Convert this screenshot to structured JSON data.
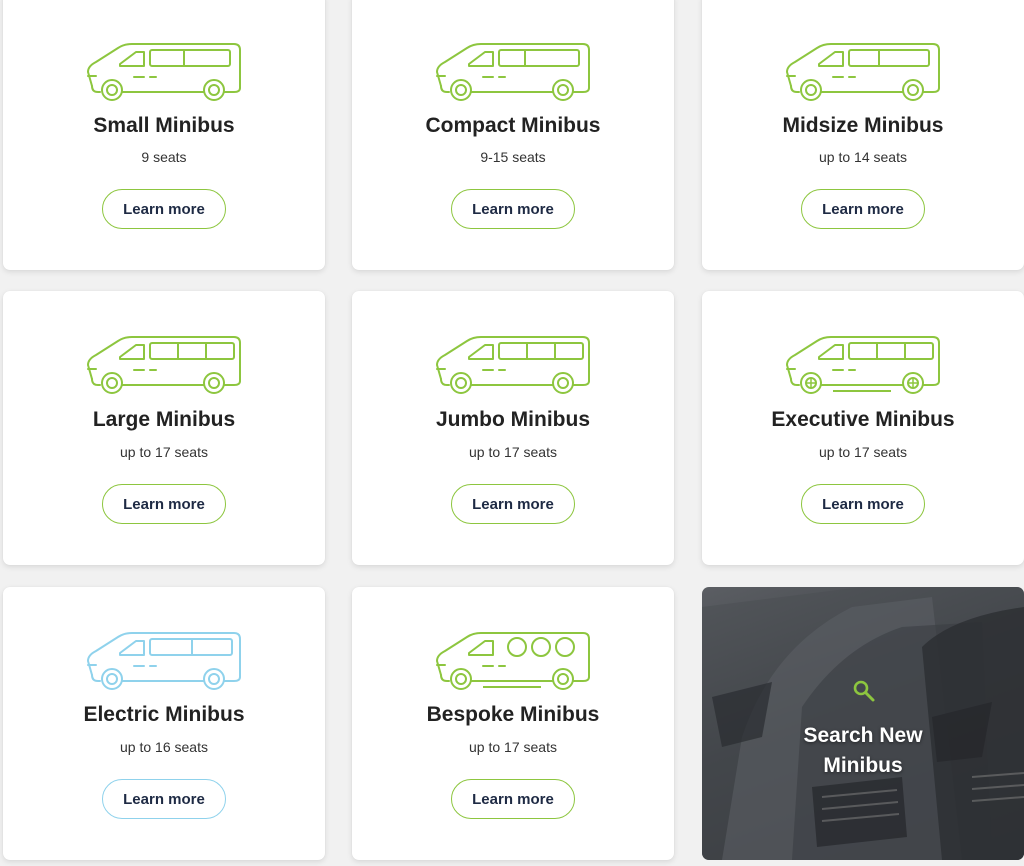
{
  "colors": {
    "accent_green": "#8dc63f",
    "electric_blue": "#8fd2ec",
    "text_dark": "#1e2a44"
  },
  "cards": [
    {
      "title": "Small Minibus",
      "seats": "9 seats",
      "button": "Learn more",
      "icon": "minibus-icon"
    },
    {
      "title": "Compact Minibus",
      "seats": "9-15 seats",
      "button": "Learn more",
      "icon": "minibus-icon"
    },
    {
      "title": "Midsize Minibus",
      "seats": "up to 14 seats",
      "button": "Learn more",
      "icon": "minibus-icon"
    },
    {
      "title": "Large Minibus",
      "seats": "up to 17 seats",
      "button": "Learn more",
      "icon": "large-minibus-icon"
    },
    {
      "title": "Jumbo Minibus",
      "seats": "up to 17 seats",
      "button": "Learn more",
      "icon": "jumbo-minibus-icon"
    },
    {
      "title": "Executive Minibus",
      "seats": "up to 17 seats",
      "button": "Learn more",
      "icon": "executive-minibus-icon"
    },
    {
      "title": "Electric Minibus",
      "seats": "up to 16 seats",
      "button": "Learn more",
      "icon": "electric-minibus-icon"
    },
    {
      "title": "Bespoke Minibus",
      "seats": "up to 17 seats",
      "button": "Learn more",
      "icon": "bespoke-minibus-icon"
    }
  ],
  "search_card": {
    "title_line1": "Search New",
    "title_line2": "Minibus",
    "icon": "search-icon"
  }
}
